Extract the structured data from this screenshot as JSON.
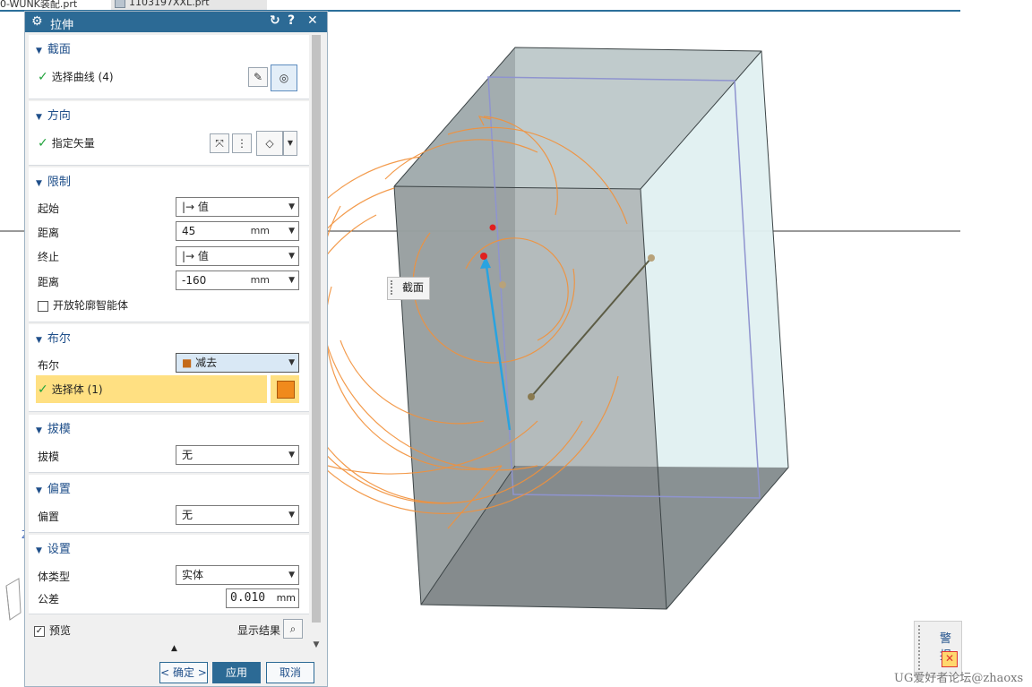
{
  "tabs": [
    {
      "label": "0-WUNK装配.prt"
    },
    {
      "label": "1103197XXL.prt"
    }
  ],
  "dialog": {
    "title": "拉伸",
    "sections": {
      "section": {
        "title": "截面",
        "select_curve_label": "选择曲线 (4)"
      },
      "direction": {
        "title": "方向",
        "vector_label": "指定矢量"
      },
      "limits": {
        "title": "限制",
        "start_label": "起始",
        "start_value": "值",
        "start_distance_label": "距离",
        "start_distance_value": "45",
        "start_distance_unit": "mm",
        "end_label": "终止",
        "end_value": "值",
        "end_distance_label": "距离",
        "end_distance_value": "-160",
        "end_distance_unit": "mm",
        "open_profile_label": "开放轮廓智能体",
        "open_profile_checked": false
      },
      "boolean": {
        "title": "布尔",
        "boolean_label": "布尔",
        "boolean_value": "减去",
        "select_body_label": "选择体 (1)"
      },
      "draft": {
        "title": "拔模",
        "draft_label": "拔模",
        "draft_value": "无"
      },
      "offset": {
        "title": "偏置",
        "offset_label": "偏置",
        "offset_value": "无"
      },
      "settings": {
        "title": "设置",
        "body_type_label": "体类型",
        "body_type_value": "实体",
        "tolerance_label": "公差",
        "tolerance_value": "0.010",
        "tolerance_unit": "mm"
      }
    },
    "preview": {
      "label": "预览",
      "checked": true,
      "show_result_label": "显示结果"
    },
    "buttons": {
      "ok": "< 确定 >",
      "apply": "应用",
      "cancel": "取消"
    }
  },
  "viewport": {
    "section_label": "截面",
    "alert_label": "警报"
  },
  "watermark": "UG爱好者论坛@zhaoxs",
  "colors": {
    "title_bar": "#2c6a95",
    "section_header": "#1f4f8a",
    "highlight": "#ffe082",
    "curve_orange": "#f2913a",
    "box_gray": "#7d8486",
    "vector_blue": "#29a3e0"
  }
}
